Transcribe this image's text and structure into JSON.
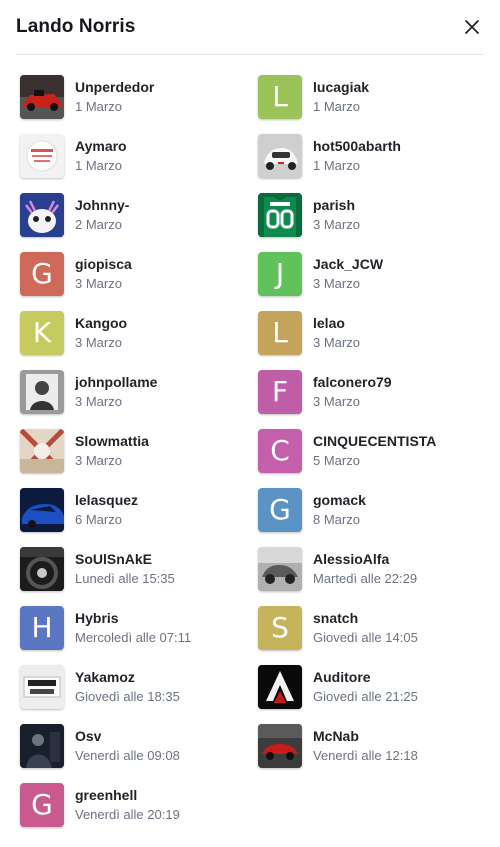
{
  "dialog": {
    "title": "Lando Norris",
    "close_icon": "close-icon"
  },
  "users": [
    {
      "name": "Unperdedor",
      "date": "1 Marzo",
      "avatar": {
        "type": "photo",
        "icon": "race-car-photo",
        "bg": "#7a1a14"
      }
    },
    {
      "name": "lucagiak",
      "date": "1 Marzo",
      "avatar": {
        "type": "letter",
        "letter": "L",
        "bg": "#9cc25a"
      }
    },
    {
      "name": "Aymaro",
      "date": "1 Marzo",
      "avatar": {
        "type": "photo",
        "icon": "default-profile-image",
        "bg": "#f1f1f1"
      }
    },
    {
      "name": "hot500abarth",
      "date": "1 Marzo",
      "avatar": {
        "type": "photo",
        "icon": "white-car-photo",
        "bg": "#c9c9c9"
      }
    },
    {
      "name": "Johnny-",
      "date": "2 Marzo",
      "avatar": {
        "type": "photo",
        "icon": "axolotl-photo",
        "bg": "#1d2d6b"
      }
    },
    {
      "name": "parish",
      "date": "3 Marzo",
      "avatar": {
        "type": "photo",
        "icon": "jersey-00-photo",
        "bg": "#0d7a46"
      }
    },
    {
      "name": "giopisca",
      "date": "3 Marzo",
      "avatar": {
        "type": "letter",
        "letter": "G",
        "bg": "#cf6a5b"
      }
    },
    {
      "name": "Jack_JCW",
      "date": "3 Marzo",
      "avatar": {
        "type": "letter",
        "letter": "J",
        "bg": "#61c25c"
      }
    },
    {
      "name": "Kangoo",
      "date": "3 Marzo",
      "avatar": {
        "type": "letter",
        "letter": "K",
        "bg": "#c6cb5f"
      }
    },
    {
      "name": "lelao",
      "date": "3 Marzo",
      "avatar": {
        "type": "letter",
        "letter": "L",
        "bg": "#c4a45c"
      }
    },
    {
      "name": "johnpollame",
      "date": "3 Marzo",
      "avatar": {
        "type": "photo",
        "icon": "portrait-bw-photo",
        "bg": "#8a8a8a"
      }
    },
    {
      "name": "falconero79",
      "date": "3 Marzo",
      "avatar": {
        "type": "letter",
        "letter": "F",
        "bg": "#c05fa7"
      }
    },
    {
      "name": "Slowmattia",
      "date": "3 Marzo",
      "avatar": {
        "type": "photo",
        "icon": "abstract-photo",
        "bg": "#d8c7b0"
      }
    },
    {
      "name": "CINQUECENTISTA",
      "date": "5 Marzo",
      "avatar": {
        "type": "letter",
        "letter": "C",
        "bg": "#c45fac"
      }
    },
    {
      "name": "lelasquez",
      "date": "6 Marzo",
      "avatar": {
        "type": "photo",
        "icon": "blue-car-photo",
        "bg": "#1a3f99"
      }
    },
    {
      "name": "gomack",
      "date": "8 Marzo",
      "avatar": {
        "type": "letter",
        "letter": "G",
        "bg": "#5b93c5"
      }
    },
    {
      "name": "SoUlSnAkE",
      "date": "Lunedì alle 15:35",
      "avatar": {
        "type": "photo",
        "icon": "steering-wheel-photo",
        "bg": "#2a2a2a"
      }
    },
    {
      "name": "AlessioAlfa",
      "date": "Martedì alle 22:29",
      "avatar": {
        "type": "photo",
        "icon": "vintage-car-photo",
        "bg": "#9a9a9a"
      }
    },
    {
      "name": "Hybris",
      "date": "Mercoledì alle 07:11",
      "avatar": {
        "type": "letter",
        "letter": "H",
        "bg": "#5b77c4"
      }
    },
    {
      "name": "snatch",
      "date": "Giovedì alle 14:05",
      "avatar": {
        "type": "letter",
        "letter": "S",
        "bg": "#c5b45c"
      }
    },
    {
      "name": "Yakamoz",
      "date": "Giovedì alle 18:35",
      "avatar": {
        "type": "photo",
        "icon": "car-star-logo",
        "bg": "#e8e8e8"
      }
    },
    {
      "name": "Auditore",
      "date": "Giovedì alle 21:25",
      "avatar": {
        "type": "photo",
        "icon": "assassin-logo",
        "bg": "#111111"
      }
    },
    {
      "name": "Osv",
      "date": "Venerdì alle 09:08",
      "avatar": {
        "type": "photo",
        "icon": "dark-figure-photo",
        "bg": "#1e2430"
      }
    },
    {
      "name": "McNab",
      "date": "Venerdì alle 12:18",
      "avatar": {
        "type": "photo",
        "icon": "red-car-photo",
        "bg": "#4a4a4a"
      }
    },
    {
      "name": "greenhell",
      "date": "Venerdì alle 20:19",
      "avatar": {
        "type": "letter",
        "letter": "G",
        "bg": "#c85a8f"
      }
    }
  ]
}
